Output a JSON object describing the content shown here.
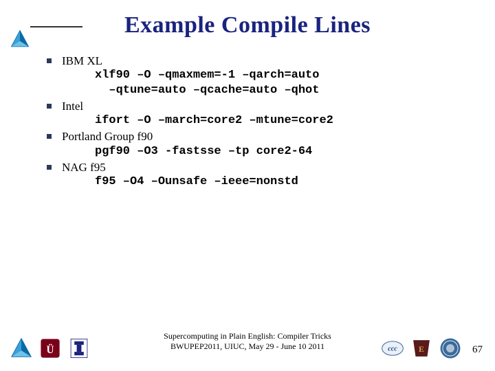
{
  "title": "Example Compile Lines",
  "items": [
    {
      "label": "IBM XL",
      "command": "xlf90 –O –qmaxmem=-1 –qarch=auto\n  –qtune=auto –qcache=auto –qhot"
    },
    {
      "label": "Intel",
      "command": "ifort –O –march=core2 –mtune=core2"
    },
    {
      "label": "Portland Group f90",
      "command": "pgf90 –O3 -fastsse –tp core2-64"
    },
    {
      "label": "NAG f95",
      "command": "f95 –O4 –Ounsafe –ieee=nonstd"
    }
  ],
  "footer": {
    "line1": "Supercomputing in Plain English: Compiler Tricks",
    "line2": "BWUPEP2011, UIUC, May 29 - June 10 2011"
  },
  "page_number": "67"
}
